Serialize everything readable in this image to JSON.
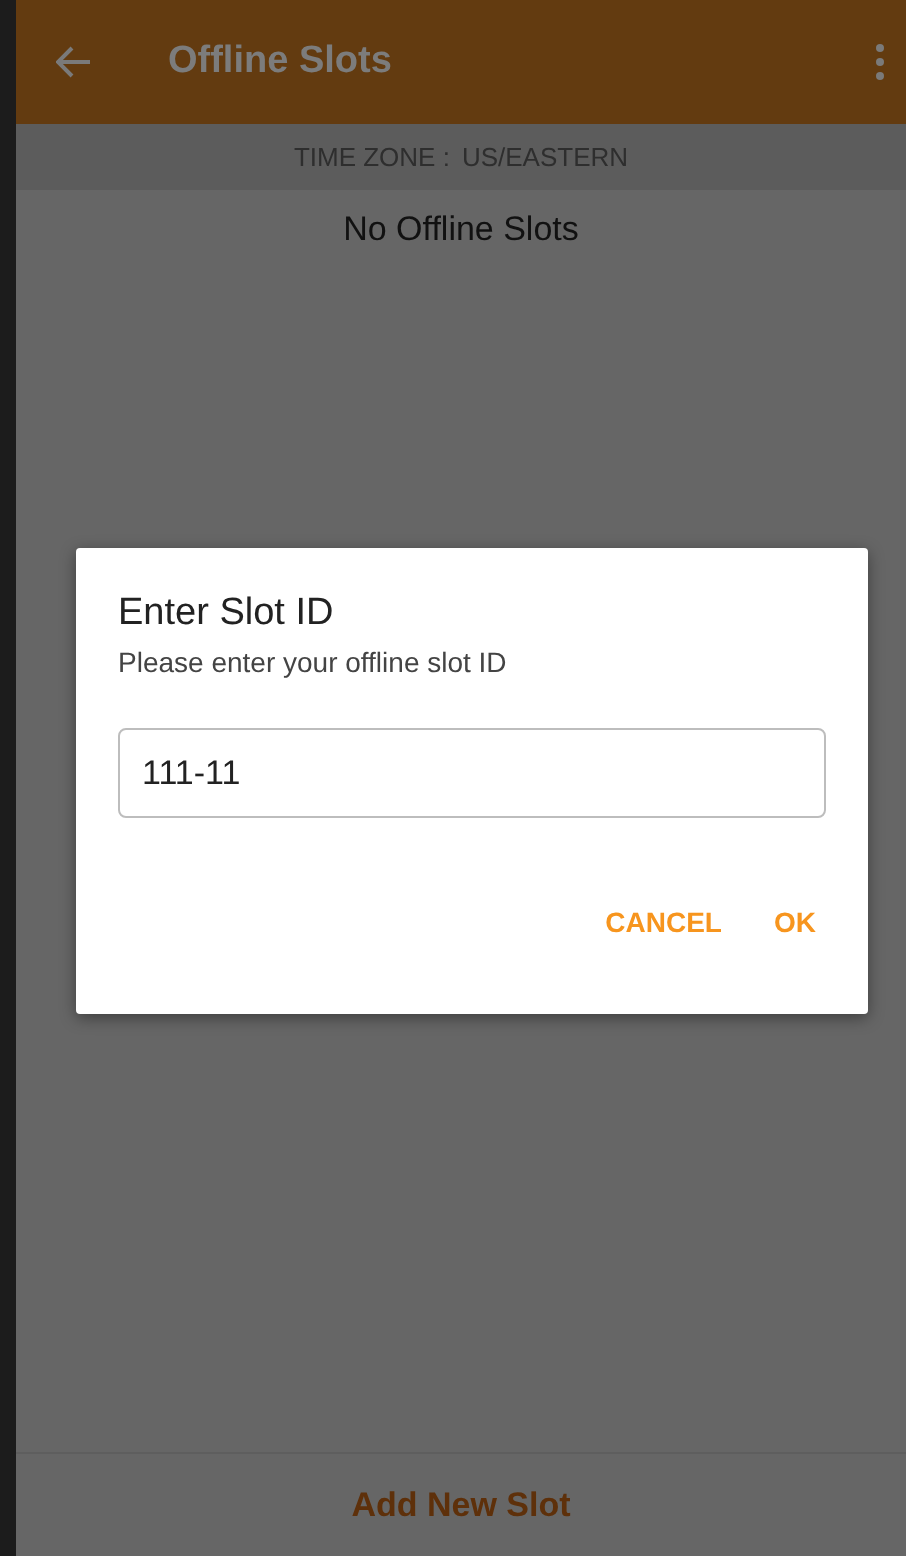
{
  "app_bar": {
    "title": "Offline Slots"
  },
  "time_zone": {
    "label": "TIME ZONE :",
    "value": "US/EASTERN"
  },
  "empty_message": "No Offline Slots",
  "bottom_action": "Add New Slot",
  "dialog": {
    "title": "Enter Slot ID",
    "message": "Please enter your offline slot ID",
    "value": "111-11",
    "buttons": [
      {
        "label": "CANCEL"
      },
      {
        "label": "OK"
      }
    ]
  }
}
